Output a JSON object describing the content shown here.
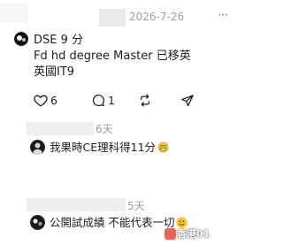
{
  "top": {
    "date": "2026-7-26",
    "more_icon": "more-icon"
  },
  "comment1": {
    "lines": [
      "DSE 9 分",
      "Fd hd degree Master 已移英",
      "英國IT9"
    ],
    "actions": {
      "like_count": "6",
      "reply_count": "1"
    }
  },
  "comment2": {
    "time": "6天",
    "text": "我果時CE理科得11分"
  },
  "comment3": {
    "time": "5天",
    "text": "公開試成績 不能代表一切"
  },
  "watermark": {
    "text": "香港01"
  },
  "colors": {
    "background": "#ffffff",
    "text": "#1c1e21",
    "muted": "#9aa0a6",
    "emoji": "#f7c22b"
  },
  "icons": [
    "heart-icon",
    "reply-bubble-icon",
    "repost-icon",
    "share-send-icon",
    "grinning-sweat-emoji",
    "smiling-emoji"
  ]
}
